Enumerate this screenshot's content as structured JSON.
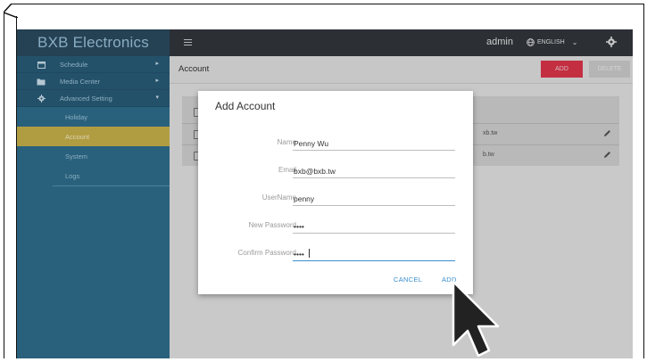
{
  "app": {
    "brand": "BXB Electronics",
    "user": "admin",
    "language": "ENGLISH"
  },
  "sidebar": {
    "items": [
      {
        "label": "Schedule",
        "icon": "calendar-icon"
      },
      {
        "label": "Media Center",
        "icon": "folder-icon"
      },
      {
        "label": "Advanced Setting",
        "icon": "gear-icon"
      }
    ],
    "subitems": [
      {
        "label": "Holiday",
        "active": false
      },
      {
        "label": "Account",
        "active": true
      },
      {
        "label": "System",
        "active": false
      },
      {
        "label": "Logs",
        "active": false
      }
    ]
  },
  "page": {
    "title": "Account",
    "add_label": "ADD",
    "delete_label": "DELETE"
  },
  "table": {
    "rows": [
      {
        "email_fragment": "xb.tw"
      },
      {
        "email_fragment": "b.tw"
      }
    ]
  },
  "dialog": {
    "title": "Add Account",
    "fields": {
      "name": {
        "label": "Name",
        "value": "Penny Wu"
      },
      "email": {
        "label": "Email",
        "value": "bxb@bxb.tw"
      },
      "username": {
        "label": "UserName",
        "value": "penny"
      },
      "new_password": {
        "label": "New Password",
        "value": "••••"
      },
      "confirm_password": {
        "label": "Confirm Password",
        "value": "••••"
      }
    },
    "cancel_label": "CANCEL",
    "add_label": "ADD"
  },
  "colors": {
    "sidebar": "#2f6f8f",
    "topbar": "#33373d",
    "active_item": "#c9b34a",
    "add_button": "#e0354b",
    "accent": "#3a8fce"
  }
}
